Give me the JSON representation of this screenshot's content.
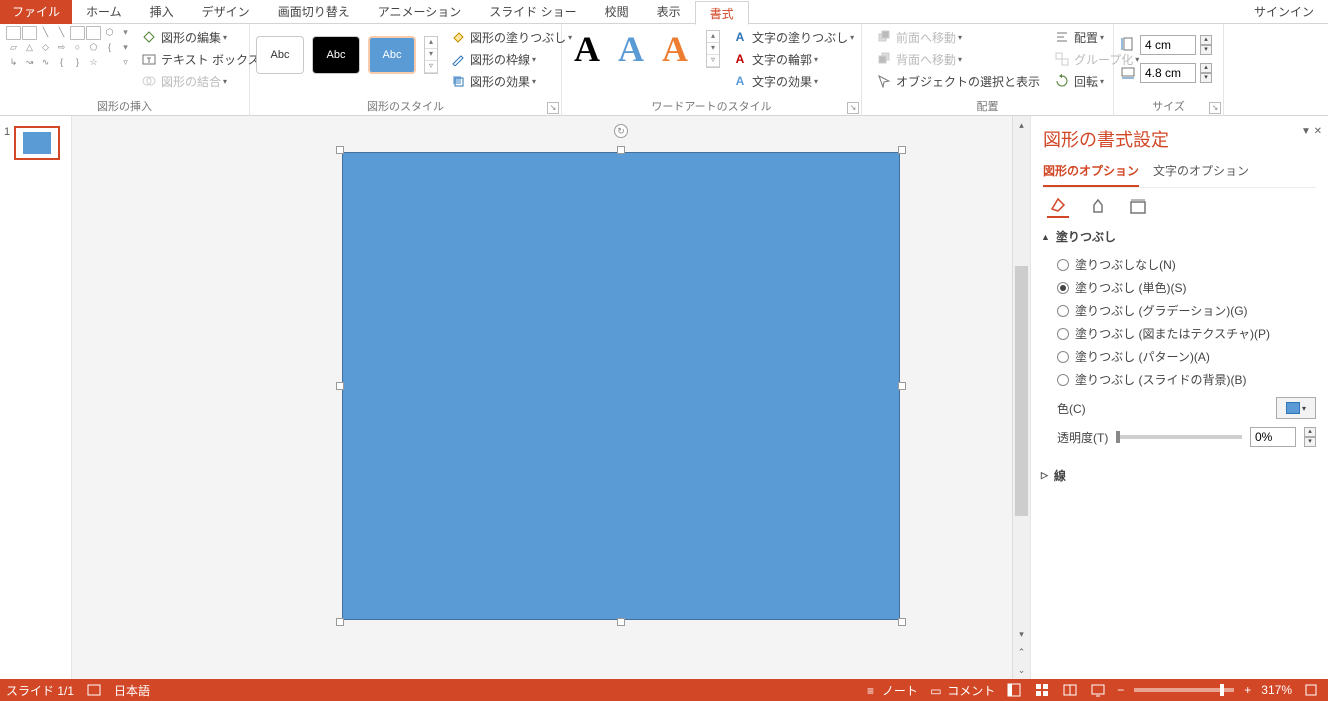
{
  "tabs": {
    "file": "ファイル",
    "home": "ホーム",
    "insert": "挿入",
    "design": "デザイン",
    "transitions": "画面切り替え",
    "animations": "アニメーション",
    "slideshow": "スライド ショー",
    "review": "校閲",
    "view": "表示",
    "format": "書式",
    "signin": "サインイン"
  },
  "ribbon": {
    "insert_shapes": {
      "label": "図形の挿入",
      "edit_shape": "図形の編集",
      "text_box": "テキスト ボックス",
      "merge_shapes": "図形の結合"
    },
    "shape_styles": {
      "label": "図形のスタイル",
      "swatch_text": "Abc",
      "shape_fill": "図形の塗りつぶし",
      "shape_outline": "図形の枠線",
      "shape_effects": "図形の効果"
    },
    "wordart": {
      "label": "ワードアートのスタイル",
      "glyph": "A",
      "text_fill": "文字の塗りつぶし",
      "text_outline": "文字の輪郭",
      "text_effects": "文字の効果"
    },
    "arrange": {
      "label": "配置",
      "bring_forward": "前面へ移動",
      "send_backward": "背面へ移動",
      "selection_pane": "オブジェクトの選択と表示",
      "align": "配置",
      "group": "グループ化",
      "rotate": "回転"
    },
    "size": {
      "label": "サイズ",
      "height": "4 cm",
      "width": "4.8 cm"
    }
  },
  "thumbs": {
    "n1": "1"
  },
  "pane": {
    "title": "図形の書式設定",
    "tab_shape": "図形のオプション",
    "tab_text": "文字のオプション",
    "section_fill": "塗りつぶし",
    "fill_none": "塗りつぶしなし(N)",
    "fill_solid": "塗りつぶし (単色)(S)",
    "fill_gradient": "塗りつぶし (グラデーション)(G)",
    "fill_picture": "塗りつぶし (図またはテクスチャ)(P)",
    "fill_pattern": "塗りつぶし (パターン)(A)",
    "fill_slidebg": "塗りつぶし (スライドの背景)(B)",
    "color_label": "色(C)",
    "transparency_label": "透明度(T)",
    "transparency_value": "0%",
    "section_line": "線"
  },
  "status": {
    "slide": "スライド 1/1",
    "lang": "日本語",
    "notes": "ノート",
    "comments": "コメント",
    "zoom": "317%"
  }
}
